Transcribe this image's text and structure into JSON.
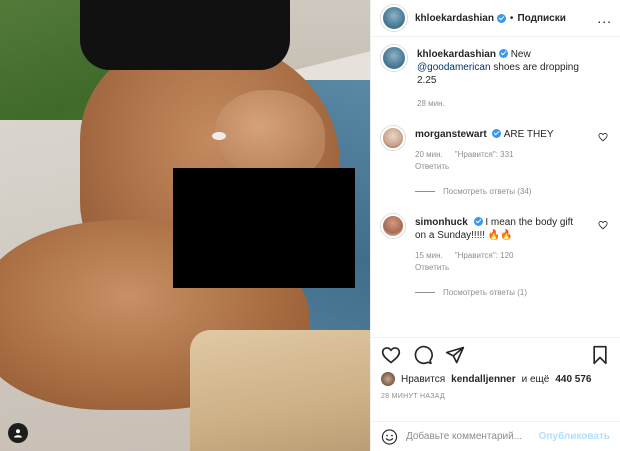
{
  "header": {
    "username": "khloekardashian",
    "separator": "•",
    "follow_label": "Подписки",
    "more_label": "..."
  },
  "caption": {
    "username": "khloekardashian",
    "text_before": "New",
    "mention": "@goodamerican",
    "text_after": "shoes are dropping 2.25",
    "time": "28 мин."
  },
  "comments": [
    {
      "username": "morganstewart",
      "text": "ARE THEY",
      "time": "20 мин.",
      "likes": "\"Нравится\": 331",
      "reply_label": "Ответить",
      "view_replies": "Посмотреть ответы (34)"
    },
    {
      "username": "simonhuck",
      "text": "I mean the body gift on a Sunday!!!!! 🔥🔥",
      "time": "15 мин.",
      "likes": "\"Нравится\": 120",
      "reply_label": "Ответить",
      "view_replies": "Посмотреть ответы (1)"
    }
  ],
  "likes": {
    "prefix": "Нравится",
    "user": "kendalljenner",
    "suffix": "и ещё",
    "count": "440 576"
  },
  "posted": "28 МИНУТ НАЗАД",
  "add_comment": {
    "placeholder": "Добавьте комментарий...",
    "publish_label": "Опубликовать"
  },
  "icons": {
    "like": "heart-icon",
    "comment": "comment-icon",
    "share": "share-icon",
    "save": "bookmark-icon",
    "emoji": "emoji-icon"
  },
  "colors": {
    "link": "#00376b",
    "verified": "#3897f0",
    "publish_disabled": "#b2dffc",
    "muted": "#8e8e8e"
  }
}
